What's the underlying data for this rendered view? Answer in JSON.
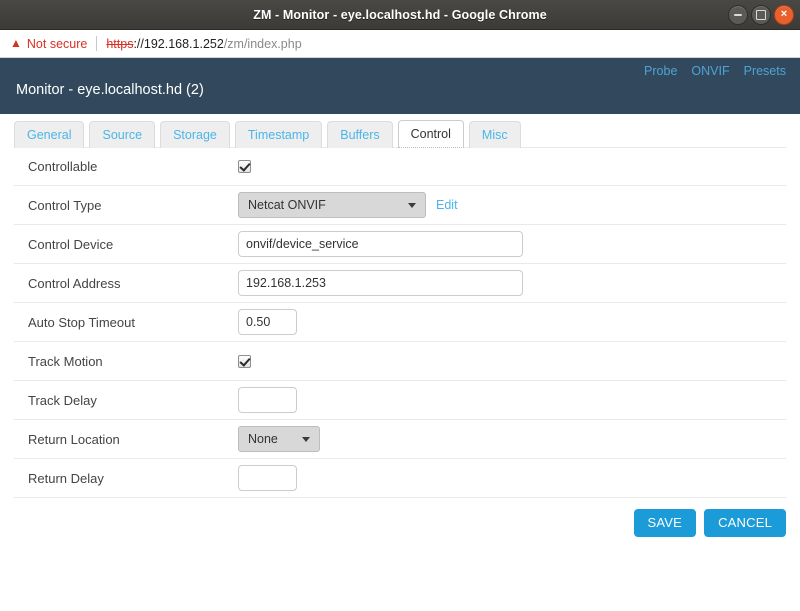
{
  "window": {
    "title": "ZM - Monitor - eye.localhost.hd - Google Chrome",
    "controls": {
      "minimize_label": "−",
      "maximize_label": "□",
      "close_label": "×"
    }
  },
  "browser": {
    "security_icon": "warning-triangle-icon",
    "security_label": "Not secure",
    "url_scheme": "https",
    "url_separator": "://",
    "url_host": "192.168.1.252",
    "url_path": "/zm/index.php"
  },
  "header": {
    "title": "Monitor - eye.localhost.hd (2)",
    "nav": [
      {
        "label": "Probe"
      },
      {
        "label": "ONVIF"
      },
      {
        "label": "Presets"
      }
    ]
  },
  "tabs": [
    {
      "label": "General",
      "active": false
    },
    {
      "label": "Source",
      "active": false
    },
    {
      "label": "Storage",
      "active": false
    },
    {
      "label": "Timestamp",
      "active": false
    },
    {
      "label": "Buffers",
      "active": false
    },
    {
      "label": "Control",
      "active": true
    },
    {
      "label": "Misc",
      "active": false
    }
  ],
  "form": {
    "controllable": {
      "label": "Controllable",
      "checked": true
    },
    "control_type": {
      "label": "Control Type",
      "value": "Netcat ONVIF",
      "edit_label": "Edit"
    },
    "control_device": {
      "label": "Control Device",
      "value": "onvif/device_service",
      "placeholder": ""
    },
    "control_address": {
      "label": "Control Address",
      "value": "192.168.1.253",
      "placeholder": ""
    },
    "auto_stop_timeout": {
      "label": "Auto Stop Timeout",
      "value": "0.50",
      "placeholder": ""
    },
    "track_motion": {
      "label": "Track Motion",
      "checked": true
    },
    "track_delay": {
      "label": "Track Delay",
      "value": "",
      "placeholder": ""
    },
    "return_location": {
      "label": "Return Location",
      "value": "None"
    },
    "return_delay": {
      "label": "Return Delay",
      "value": "",
      "placeholder": ""
    }
  },
  "footer": {
    "save_label": "SAVE",
    "cancel_label": "CANCEL"
  },
  "colors": {
    "header_bg": "#32495d",
    "link_blue": "#4ab6e8",
    "button_blue": "#1b9bd8",
    "insecure_red": "#d93025"
  }
}
